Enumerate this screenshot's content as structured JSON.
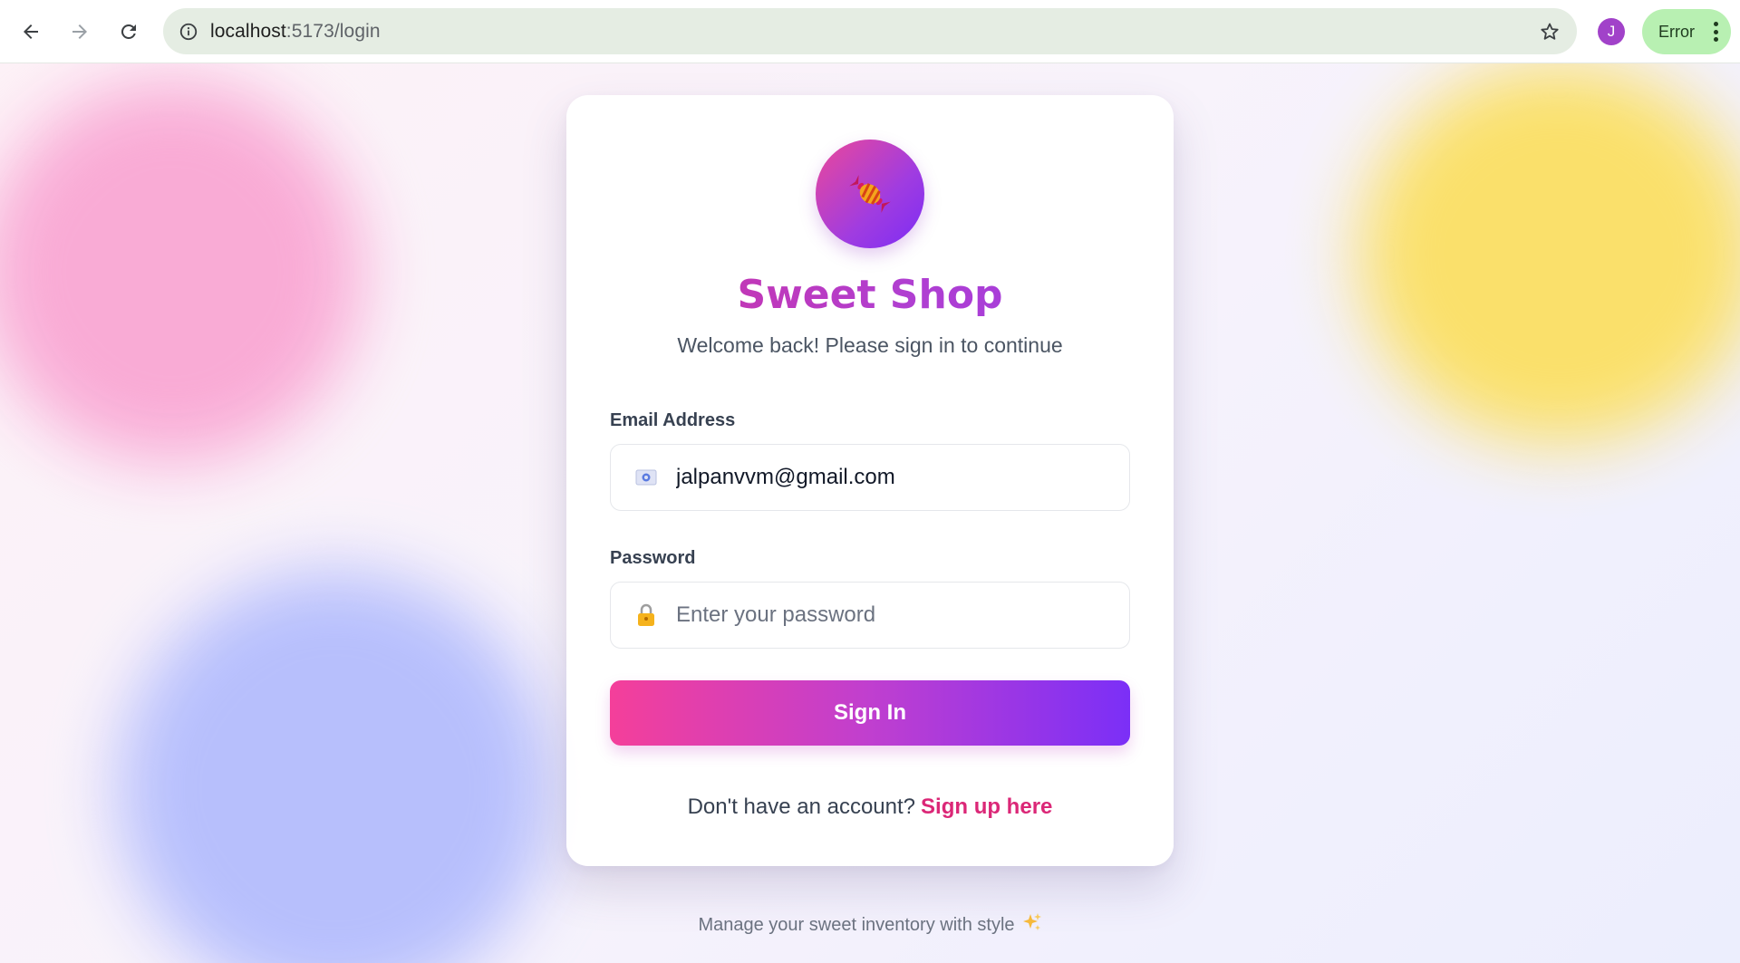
{
  "browser": {
    "url_host": "localhost",
    "url_path": ":5173/login",
    "profile_initial": "J",
    "error_label": "Error",
    "icons": {
      "back": "back-arrow-icon",
      "forward": "forward-arrow-icon",
      "reload": "reload-icon",
      "site_info": "info-icon",
      "bookmark": "star-icon",
      "menu": "kebab-menu-icon"
    }
  },
  "login": {
    "logo_icon": "candy-icon",
    "title": "Sweet Shop",
    "subtitle": "Welcome back! Please sign in to continue",
    "email": {
      "label": "Email Address",
      "value": "jalpanvvm@gmail.com",
      "icon": "email-icon"
    },
    "password": {
      "label": "Password",
      "placeholder": "Enter your password",
      "icon": "lock-icon"
    },
    "submit_label": "Sign In",
    "signup_prompt": "Don't have an account?",
    "signup_link": "Sign up here"
  },
  "footer": {
    "text": "Manage your sweet inventory with style",
    "icon": "sparkles-icon"
  },
  "colors": {
    "brand_pink": "#ec4899",
    "brand_purple": "#7c2cf5",
    "link": "#db2777",
    "chrome_omnibox": "#e5ede3",
    "error_chip": "#b8f0b2"
  }
}
